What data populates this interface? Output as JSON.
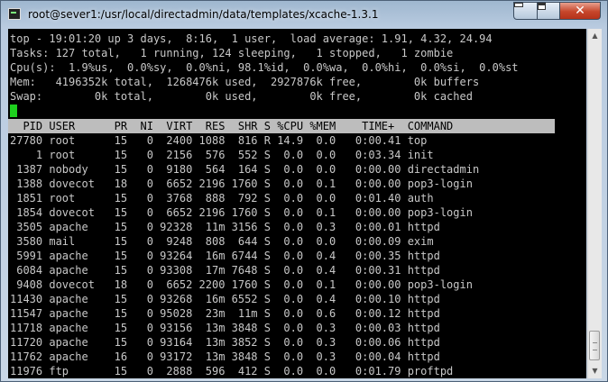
{
  "window": {
    "title": "root@sever1:/usr/local/directadmin/data/templates/xcache-1.3.1",
    "close_glyph": "✕"
  },
  "top_summary": [
    "top - 19:01:20 up 3 days,  8:16,  1 user,  load average: 1.91, 4.32, 24.94",
    "Tasks: 127 total,   1 running, 124 sleeping,   1 stopped,   1 zombie",
    "Cpu(s):  1.9%us,  0.0%sy,  0.0%ni, 98.1%id,  0.0%wa,  0.0%hi,  0.0%si,  0.0%st",
    "Mem:   4196352k total,  1268476k used,  2927876k free,        0k buffers",
    "Swap:        0k total,        0k used,        0k free,        0k cached"
  ],
  "process_header": "  PID USER      PR  NI  VIRT  RES  SHR S %CPU %MEM    TIME+  COMMAND",
  "processes": [
    "27780 root      15   0  2400 1088  816 R 14.9  0.0   0:00.41 top",
    "    1 root      15   0  2156  576  552 S  0.0  0.0   0:03.34 init",
    " 1387 nobody    15   0  9180  564  164 S  0.0  0.0   0:00.00 directadmin",
    " 1388 dovecot   18   0  6652 2196 1760 S  0.0  0.1   0:00.00 pop3-login",
    " 1851 root      15   0  3768  888  792 S  0.0  0.0   0:01.40 auth",
    " 1854 dovecot   15   0  6652 2196 1760 S  0.0  0.1   0:00.00 pop3-login",
    " 3505 apache    15   0 92328  11m 3156 S  0.0  0.3   0:00.01 httpd",
    " 3580 mail      15   0  9248  808  644 S  0.0  0.0   0:00.09 exim",
    " 5991 apache    15   0 93264  16m 6744 S  0.0  0.4   0:00.35 httpd",
    " 6084 apache    15   0 93308  17m 7648 S  0.0  0.4   0:00.31 httpd",
    " 9408 dovecot   18   0  6652 2200 1760 S  0.0  0.1   0:00.00 pop3-login",
    "11430 apache    15   0 93268  16m 6552 S  0.0  0.4   0:00.10 httpd",
    "11547 apache    15   0 95028  23m  11m S  0.0  0.6   0:00.12 httpd",
    "11718 apache    15   0 93156  13m 3848 S  0.0  0.3   0:00.03 httpd",
    "11720 apache    15   0 93164  13m 3852 S  0.0  0.3   0:00.06 httpd",
    "11762 apache    16   0 93172  13m 3848 S  0.0  0.3   0:00.04 httpd",
    "11976 ftp       15   0  2888  596  412 S  0.0  0.0   0:01.79 proftpd"
  ],
  "colors": {
    "terminal_bg": "#000000",
    "terminal_fg": "#c8c8c8",
    "cursor": "#1ed01e",
    "header_bar": "#bdbdbd"
  }
}
